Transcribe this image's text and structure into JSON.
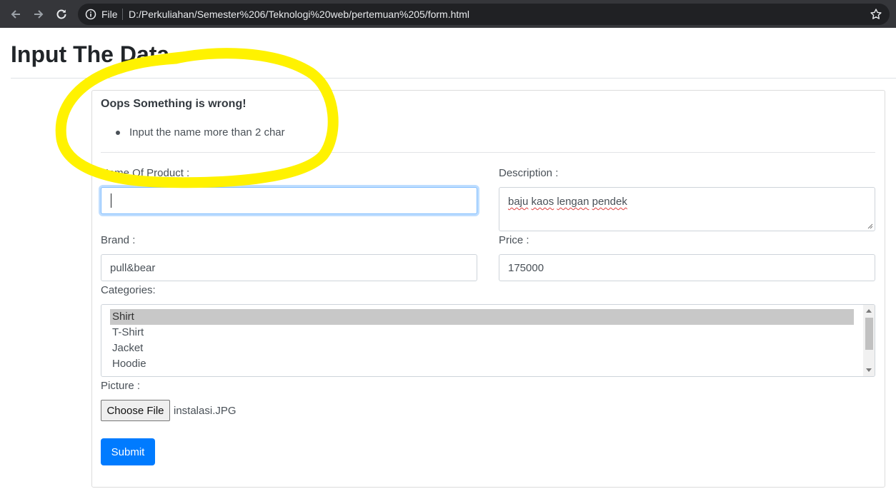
{
  "browser": {
    "file_label": "File",
    "url": "D:/Perkuliahan/Semester%206/Teknologi%20web/pertemuan%205/form.html"
  },
  "page": {
    "title": "Input The Data"
  },
  "error": {
    "heading": "Oops Something is wrong!",
    "items": [
      "Input the name more than 2 char"
    ]
  },
  "form": {
    "name_label": "Name Of Product :",
    "name_value": "",
    "description_label": "Description :",
    "description_words": [
      "baju",
      "kaos",
      "lengan",
      "pendek"
    ],
    "brand_label": "Brand :",
    "brand_value": "pull&bear",
    "price_label": "Price :",
    "price_value": "175000",
    "categories_label": "Categories:",
    "categories": [
      "Shirt",
      "T-Shirt",
      "Jacket",
      "Hoodie"
    ],
    "selected_category": "Shirt",
    "picture_label": "Picture :",
    "choose_file_label": "Choose File",
    "file_name": "instalasi.JPG",
    "submit_label": "Submit"
  },
  "colors": {
    "primary": "#007bff",
    "highlight": "#fff200",
    "chrome": "#35363a"
  }
}
